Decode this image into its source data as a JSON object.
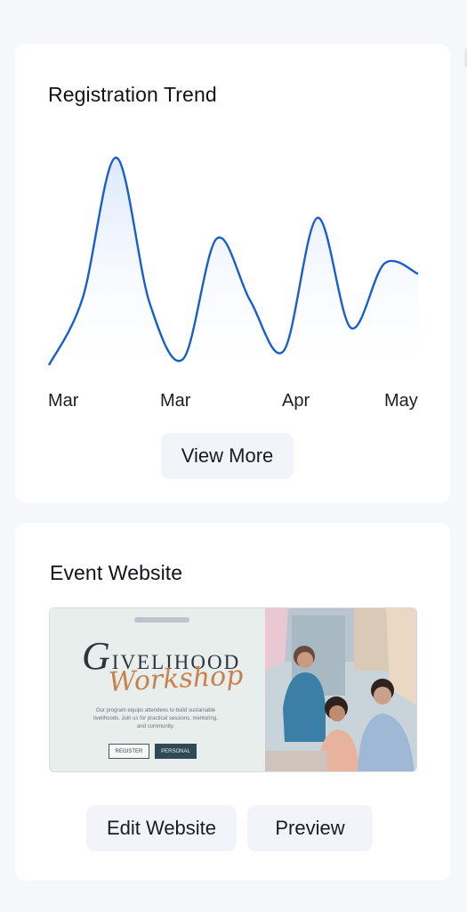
{
  "registration_trend": {
    "title": "Registration Trend",
    "view_more_label": "View More",
    "chart_data": {
      "type": "area",
      "x_tick_labels": [
        "Mar",
        "Mar",
        "Apr",
        "May"
      ],
      "series": [
        {
          "values": [
            0,
            32,
            100,
            30,
            3,
            61,
            31,
            7,
            71,
            18,
            49,
            44
          ]
        }
      ],
      "ylim": [
        0,
        100
      ],
      "grid": false,
      "colors": {
        "line": "#1a5fc9",
        "fill_top": "#d6e4fb",
        "fill_bottom": "#ffffff"
      }
    }
  },
  "event_website": {
    "title": "Event Website",
    "thumbnail": {
      "title_text": "IVELIHOOD",
      "title_initial": "G",
      "script_text": "Workshop",
      "description": "Our program equips attendees to build sustainable livelihoods. Join us for practical sessions, mentoring, and community.",
      "button_outline_label": "REGISTER",
      "button_dark_label": "PERSONAL"
    },
    "edit_label": "Edit Website",
    "preview_label": "Preview"
  }
}
